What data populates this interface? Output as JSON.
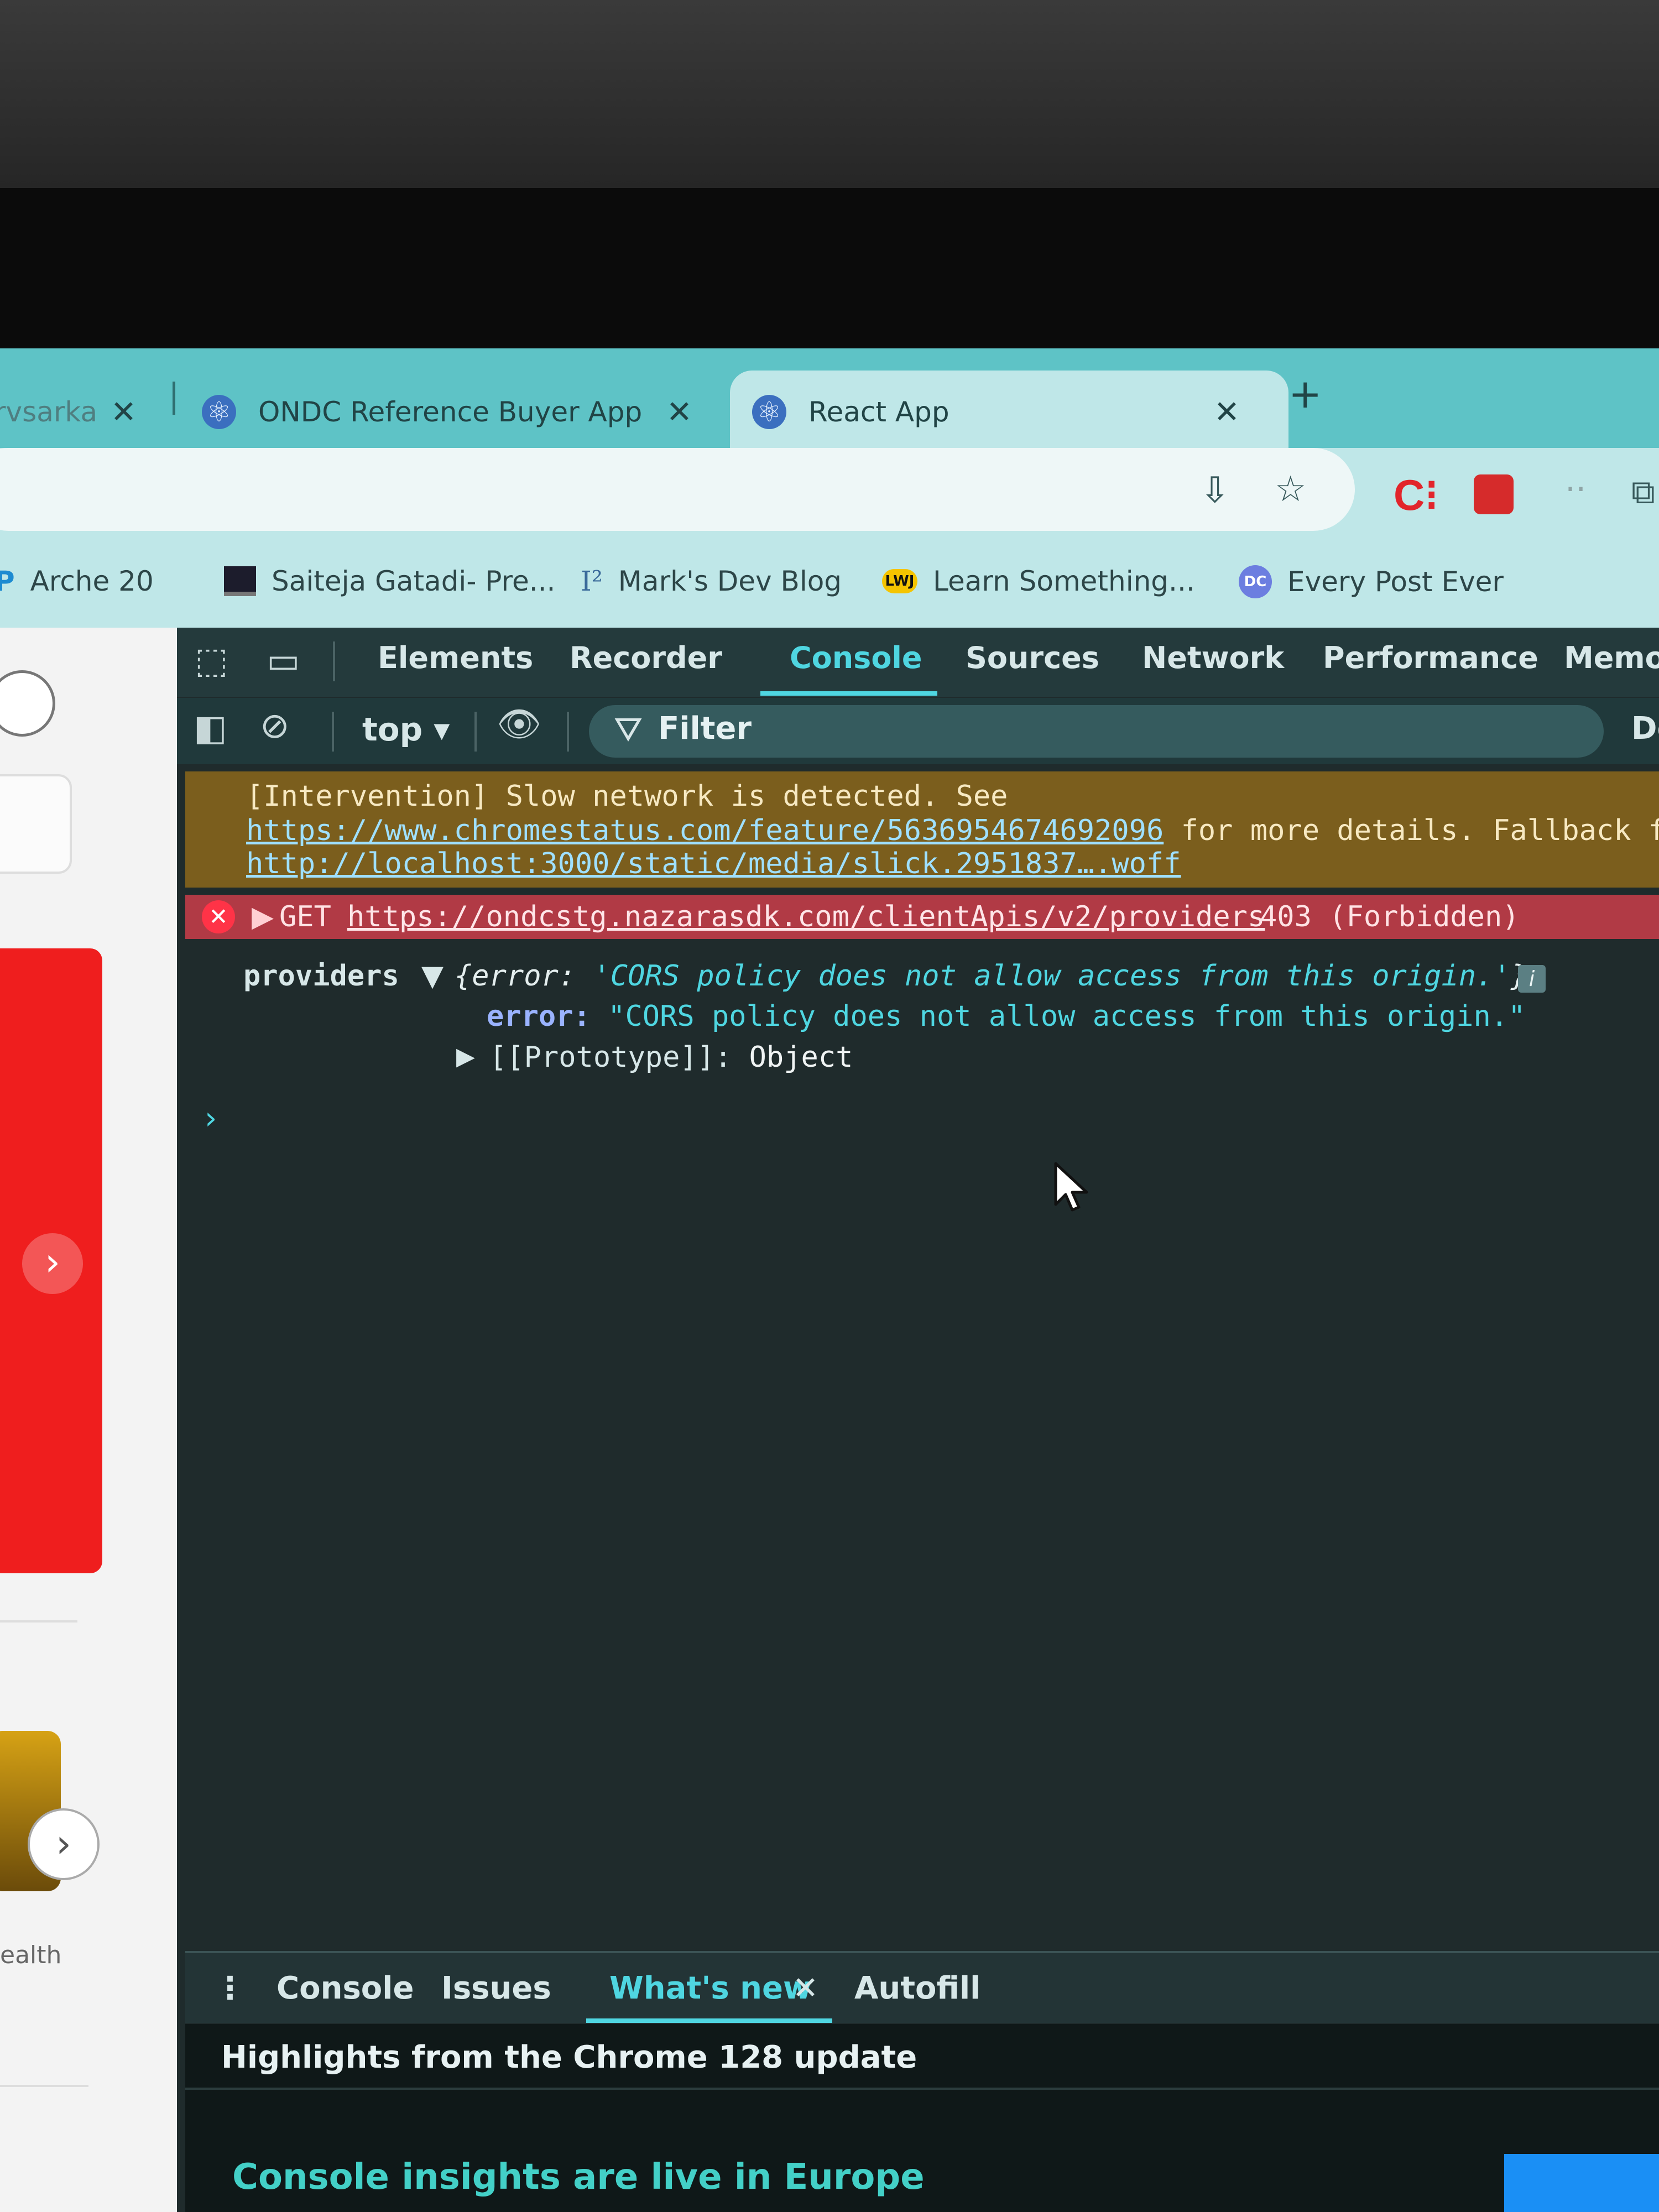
{
  "browser": {
    "tabs": [
      {
        "title": "rvsarka",
        "active": false
      },
      {
        "title": "ONDC Reference Buyer App",
        "active": false
      },
      {
        "title": "React App",
        "active": true
      }
    ],
    "new_tab": "+",
    "toolbar_icons": [
      "install-icon",
      "star-icon",
      "extension-c-icon",
      "extension-red-icon",
      "extension-dots-icon",
      "puzzle-icon"
    ]
  },
  "bookmarks": [
    {
      "label": "Arche 20",
      "icon": "p-icon"
    },
    {
      "label": "Saiteja Gatadi- Pre...",
      "icon": "laptop-icon"
    },
    {
      "label": "Mark's Dev Blog",
      "icon": "i2-icon"
    },
    {
      "label": "Learn Something...",
      "icon": "lwj-icon"
    },
    {
      "label": "Every Post Ever",
      "icon": "dc-icon"
    }
  ],
  "page": {
    "partial_text": "ealth"
  },
  "devtools": {
    "tabs": [
      "Elements",
      "Recorder",
      "Console",
      "Sources",
      "Network",
      "Performance",
      "Memor"
    ],
    "active_tab": "Console",
    "console_toolbar": {
      "context": "top ▾",
      "filter_placeholder": "Filter",
      "levels": "De"
    },
    "messages": {
      "warning": {
        "line1": "[Intervention] Slow network is detected. See",
        "link1": "https://www.chromestatus.com/feature/5636954674692096",
        "line2_rest": " for more details. Fallback fon",
        "link2": "http://localhost:3000/static/media/slick.2951837….woff"
      },
      "error": {
        "method": "GET",
        "url": "https://ondcstg.nazarasdk.com/clientApis/v2/providers",
        "status": "403 (Forbidden)"
      },
      "log": {
        "label": "providers",
        "summary_open": "{error: ",
        "summary_value": "'CORS policy does not allow access from this origin.'",
        "summary_close": "}",
        "info_badge": "i",
        "key": "error:",
        "value": "\"CORS policy does not allow access from this origin.\"",
        "prototype_key": "[[Prototype]]:",
        "prototype_value": "Object"
      },
      "prompt": "›"
    },
    "drawer": {
      "menu": "⋮",
      "tabs": [
        "Console",
        "Issues",
        "What's new",
        "Autofill"
      ],
      "active_tab": "What's new",
      "close": "✕",
      "subtitle": "Highlights from the Chrome 128 update",
      "headline": "Console insights are live in Europe"
    }
  },
  "colors": {
    "tabstrip": "#5ec3c6",
    "devtools_bg": "#1f2b2c",
    "accent": "#4fd6e1",
    "warning_bg": "#7b5e1d",
    "error_bg": "#b13a45"
  }
}
